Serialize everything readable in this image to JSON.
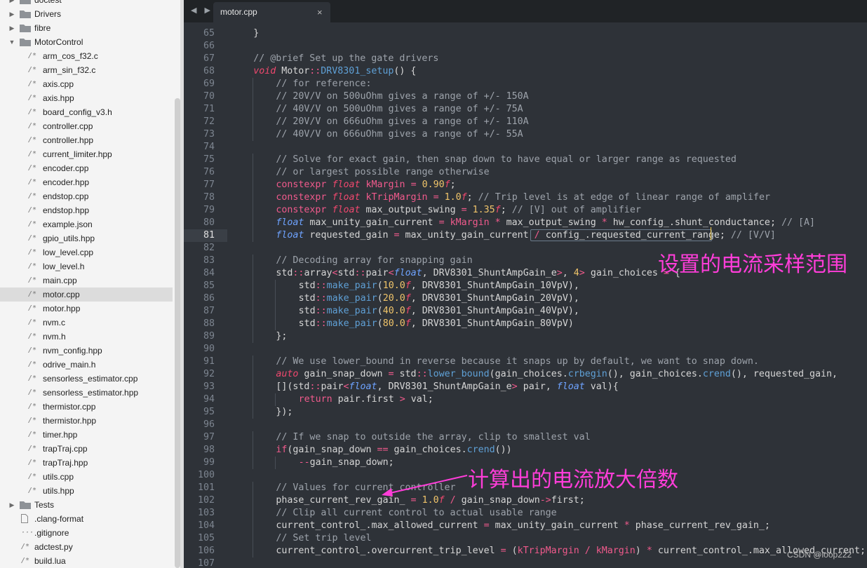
{
  "sidebar": {
    "items": [
      {
        "label": "doctest",
        "type": "folder",
        "state": "collapsed",
        "depth": 1
      },
      {
        "label": "Drivers",
        "type": "folder",
        "state": "collapsed",
        "depth": 1
      },
      {
        "label": "fibre",
        "type": "folder",
        "state": "collapsed",
        "depth": 1
      },
      {
        "label": "MotorControl",
        "type": "folder",
        "state": "open",
        "depth": 1
      },
      {
        "label": "arm_cos_f32.c",
        "type": "file",
        "depth": 2
      },
      {
        "label": "arm_sin_f32.c",
        "type": "file",
        "depth": 2
      },
      {
        "label": "axis.cpp",
        "type": "file",
        "depth": 2
      },
      {
        "label": "axis.hpp",
        "type": "file",
        "depth": 2
      },
      {
        "label": "board_config_v3.h",
        "type": "file",
        "depth": 2
      },
      {
        "label": "controller.cpp",
        "type": "file",
        "depth": 2
      },
      {
        "label": "controller.hpp",
        "type": "file",
        "depth": 2
      },
      {
        "label": "current_limiter.hpp",
        "type": "file",
        "depth": 2
      },
      {
        "label": "encoder.cpp",
        "type": "file",
        "depth": 2
      },
      {
        "label": "encoder.hpp",
        "type": "file",
        "depth": 2
      },
      {
        "label": "endstop.cpp",
        "type": "file",
        "depth": 2
      },
      {
        "label": "endstop.hpp",
        "type": "file",
        "depth": 2
      },
      {
        "label": "example.json",
        "type": "file",
        "depth": 2
      },
      {
        "label": "gpio_utils.hpp",
        "type": "file",
        "depth": 2
      },
      {
        "label": "low_level.cpp",
        "type": "file",
        "depth": 2
      },
      {
        "label": "low_level.h",
        "type": "file",
        "depth": 2
      },
      {
        "label": "main.cpp",
        "type": "file",
        "depth": 2
      },
      {
        "label": "motor.cpp",
        "type": "file",
        "depth": 2,
        "selected": true
      },
      {
        "label": "motor.hpp",
        "type": "file",
        "depth": 2
      },
      {
        "label": "nvm.c",
        "type": "file",
        "depth": 2
      },
      {
        "label": "nvm.h",
        "type": "file",
        "depth": 2
      },
      {
        "label": "nvm_config.hpp",
        "type": "file",
        "depth": 2
      },
      {
        "label": "odrive_main.h",
        "type": "file",
        "depth": 2
      },
      {
        "label": "sensorless_estimator.cpp",
        "type": "file",
        "depth": 2
      },
      {
        "label": "sensorless_estimator.hpp",
        "type": "file",
        "depth": 2
      },
      {
        "label": "thermistor.cpp",
        "type": "file",
        "depth": 2
      },
      {
        "label": "thermistor.hpp",
        "type": "file",
        "depth": 2
      },
      {
        "label": "timer.hpp",
        "type": "file",
        "depth": 2
      },
      {
        "label": "trapTraj.cpp",
        "type": "file",
        "depth": 2
      },
      {
        "label": "trapTraj.hpp",
        "type": "file",
        "depth": 2
      },
      {
        "label": "utils.cpp",
        "type": "file",
        "depth": 2
      },
      {
        "label": "utils.hpp",
        "type": "file",
        "depth": 2
      },
      {
        "label": "Tests",
        "type": "folder",
        "state": "collapsed",
        "depth": 1
      },
      {
        "label": ".clang-format",
        "type": "plainfile",
        "depth": 1
      },
      {
        "label": ".gitignore",
        "type": "dotfile",
        "depth": 1
      },
      {
        "label": "adctest.py",
        "type": "file",
        "depth": 1
      },
      {
        "label": "build.lua",
        "type": "file",
        "depth": 1
      }
    ]
  },
  "tabs": {
    "nav_label": "◀ ▶",
    "active_tab": "motor.cpp",
    "close_icon": "×"
  },
  "editor": {
    "current_line": "81",
    "lines": [
      {
        "n": "65",
        "indent": 4,
        "tokens": [
          [
            "}",
            "pl"
          ]
        ]
      },
      {
        "n": "66",
        "indent": 0,
        "tokens": []
      },
      {
        "n": "67",
        "indent": 4,
        "tokens": [
          [
            "// @brief Set up the gate drivers",
            "cm"
          ]
        ]
      },
      {
        "n": "68",
        "indent": 4,
        "tokens": [
          [
            "void",
            "kw"
          ],
          [
            " Motor",
            "pl"
          ],
          [
            "::",
            "op"
          ],
          [
            "DRV8301_setup",
            "fn"
          ],
          [
            "() {",
            "pl"
          ]
        ]
      },
      {
        "n": "69",
        "indent": 8,
        "tokens": [
          [
            "// for reference:",
            "cm"
          ]
        ]
      },
      {
        "n": "70",
        "indent": 8,
        "tokens": [
          [
            "// 20V/V on 500uOhm gives a range of +/- 150A",
            "cm"
          ]
        ]
      },
      {
        "n": "71",
        "indent": 8,
        "tokens": [
          [
            "// 40V/V on 500uOhm gives a range of +/- 75A",
            "cm"
          ]
        ]
      },
      {
        "n": "72",
        "indent": 8,
        "tokens": [
          [
            "// 20V/V on 666uOhm gives a range of +/- 110A",
            "cm"
          ]
        ]
      },
      {
        "n": "73",
        "indent": 8,
        "tokens": [
          [
            "// 40V/V on 666uOhm gives a range of +/- 55A",
            "cm"
          ]
        ]
      },
      {
        "n": "74",
        "indent": 0,
        "tokens": []
      },
      {
        "n": "75",
        "indent": 8,
        "tokens": [
          [
            "// Solve for exact gain, then snap down to have equal or larger range as requested",
            "cm"
          ]
        ]
      },
      {
        "n": "76",
        "indent": 8,
        "tokens": [
          [
            "// or largest possible range otherwise",
            "cm"
          ]
        ]
      },
      {
        "n": "77",
        "indent": 8,
        "tokens": [
          [
            "constexpr",
            "op"
          ],
          [
            " ",
            "pl"
          ],
          [
            "float",
            "kw"
          ],
          [
            " kMargin ",
            "op"
          ],
          [
            "=",
            "op"
          ],
          [
            " ",
            "pl"
          ],
          [
            "0.90",
            "nu"
          ],
          [
            "f",
            "kw"
          ],
          [
            ";",
            "pl"
          ]
        ]
      },
      {
        "n": "78",
        "indent": 8,
        "tokens": [
          [
            "constexpr",
            "op"
          ],
          [
            " ",
            "pl"
          ],
          [
            "float",
            "kw"
          ],
          [
            " kTripMargin ",
            "op"
          ],
          [
            "=",
            "op"
          ],
          [
            " ",
            "pl"
          ],
          [
            "1.0",
            "nu"
          ],
          [
            "f",
            "kw"
          ],
          [
            "; ",
            "pl"
          ],
          [
            "// Trip level is at edge of linear range of amplifer",
            "cm"
          ]
        ]
      },
      {
        "n": "79",
        "indent": 8,
        "tokens": [
          [
            "constexpr",
            "op"
          ],
          [
            " ",
            "pl"
          ],
          [
            "float",
            "kw"
          ],
          [
            " max_output_swing ",
            "pl"
          ],
          [
            "=",
            "op"
          ],
          [
            " ",
            "pl"
          ],
          [
            "1.35",
            "nu"
          ],
          [
            "f",
            "kw"
          ],
          [
            "; ",
            "pl"
          ],
          [
            "// [V] out of amplifier",
            "cm"
          ]
        ]
      },
      {
        "n": "80",
        "indent": 8,
        "tokens": [
          [
            "float",
            "ty"
          ],
          [
            " max_unity_gain_current ",
            "pl"
          ],
          [
            "=",
            "op"
          ],
          [
            " kMargin ",
            "op"
          ],
          [
            "*",
            "op"
          ],
          [
            " max_output_swing ",
            "pl"
          ],
          [
            "*",
            "op"
          ],
          [
            " hw_config_.shunt_conductance; ",
            "pl"
          ],
          [
            "// [A]",
            "cm"
          ]
        ]
      },
      {
        "n": "81",
        "indent": 8,
        "tokens": [
          [
            "float",
            "ty"
          ],
          [
            " requested_gain ",
            "pl"
          ],
          [
            "=",
            "op"
          ],
          [
            " max_unity_gain_current ",
            "pl"
          ],
          [
            "/",
            "op"
          ],
          [
            " config_.requested_current_range; ",
            "pl"
          ],
          [
            "// [V/V]",
            "cm"
          ]
        ]
      },
      {
        "n": "82",
        "indent": 0,
        "tokens": []
      },
      {
        "n": "83",
        "indent": 8,
        "tokens": [
          [
            "// Decoding array for snapping gain",
            "cm"
          ]
        ]
      },
      {
        "n": "84",
        "indent": 8,
        "tokens": [
          [
            "std",
            "pl"
          ],
          [
            "::",
            "op"
          ],
          [
            "array",
            "pl"
          ],
          [
            "<",
            "op"
          ],
          [
            "std",
            "pl"
          ],
          [
            "::",
            "op"
          ],
          [
            "pair",
            "pl"
          ],
          [
            "<",
            "op"
          ],
          [
            "float",
            "ty"
          ],
          [
            ", DRV8301_ShuntAmpGain_e",
            "pl"
          ],
          [
            ">",
            "op"
          ],
          [
            ", ",
            "pl"
          ],
          [
            "4",
            "nu"
          ],
          [
            ">",
            "op"
          ],
          [
            " gain_choices ",
            "pl"
          ],
          [
            "=",
            "op"
          ],
          [
            " {",
            "pl"
          ]
        ]
      },
      {
        "n": "85",
        "indent": 12,
        "tokens": [
          [
            "std",
            "pl"
          ],
          [
            "::",
            "op"
          ],
          [
            "make_pair",
            "fn"
          ],
          [
            "(",
            "pl"
          ],
          [
            "10.0",
            "nu"
          ],
          [
            "f",
            "kw"
          ],
          [
            ", DRV8301_ShuntAmpGain_10VpV),",
            "pl"
          ]
        ]
      },
      {
        "n": "86",
        "indent": 12,
        "tokens": [
          [
            "std",
            "pl"
          ],
          [
            "::",
            "op"
          ],
          [
            "make_pair",
            "fn"
          ],
          [
            "(",
            "pl"
          ],
          [
            "20.0",
            "nu"
          ],
          [
            "f",
            "kw"
          ],
          [
            ", DRV8301_ShuntAmpGain_20VpV),",
            "pl"
          ]
        ]
      },
      {
        "n": "87",
        "indent": 12,
        "tokens": [
          [
            "std",
            "pl"
          ],
          [
            "::",
            "op"
          ],
          [
            "make_pair",
            "fn"
          ],
          [
            "(",
            "pl"
          ],
          [
            "40.0",
            "nu"
          ],
          [
            "f",
            "kw"
          ],
          [
            ", DRV8301_ShuntAmpGain_40VpV),",
            "pl"
          ]
        ]
      },
      {
        "n": "88",
        "indent": 12,
        "tokens": [
          [
            "std",
            "pl"
          ],
          [
            "::",
            "op"
          ],
          [
            "make_pair",
            "fn"
          ],
          [
            "(",
            "pl"
          ],
          [
            "80.0",
            "nu"
          ],
          [
            "f",
            "kw"
          ],
          [
            ", DRV8301_ShuntAmpGain_80VpV)",
            "pl"
          ]
        ]
      },
      {
        "n": "89",
        "indent": 8,
        "tokens": [
          [
            "};",
            "pl"
          ]
        ]
      },
      {
        "n": "90",
        "indent": 0,
        "tokens": []
      },
      {
        "n": "91",
        "indent": 8,
        "tokens": [
          [
            "// We use lower_bound in reverse because it snaps up by default, we want to snap down.",
            "cm"
          ]
        ]
      },
      {
        "n": "92",
        "indent": 8,
        "tokens": [
          [
            "auto",
            "kw"
          ],
          [
            " gain_snap_down ",
            "pl"
          ],
          [
            "=",
            "op"
          ],
          [
            " std",
            "pl"
          ],
          [
            "::",
            "op"
          ],
          [
            "lower_bound",
            "fn"
          ],
          [
            "(gain_choices.",
            "pl"
          ],
          [
            "crbegin",
            "fn"
          ],
          [
            "(), gain_choices.",
            "pl"
          ],
          [
            "crend",
            "fn"
          ],
          [
            "(), requested_gain,",
            "pl"
          ]
        ]
      },
      {
        "n": "93",
        "indent": 8,
        "tokens": [
          [
            "[](std",
            "pl"
          ],
          [
            "::",
            "op"
          ],
          [
            "pair",
            "pl"
          ],
          [
            "<",
            "op"
          ],
          [
            "float",
            "ty"
          ],
          [
            ", DRV8301_ShuntAmpGain_e",
            "pl"
          ],
          [
            ">",
            "op"
          ],
          [
            " pair, ",
            "pl"
          ],
          [
            "float",
            "ty"
          ],
          [
            " val){",
            "pl"
          ]
        ]
      },
      {
        "n": "94",
        "indent": 12,
        "tokens": [
          [
            "return",
            "op"
          ],
          [
            " pair.first ",
            "pl"
          ],
          [
            ">",
            "op"
          ],
          [
            " val;",
            "pl"
          ]
        ]
      },
      {
        "n": "95",
        "indent": 8,
        "tokens": [
          [
            "});",
            "pl"
          ]
        ]
      },
      {
        "n": "96",
        "indent": 0,
        "tokens": []
      },
      {
        "n": "97",
        "indent": 8,
        "tokens": [
          [
            "// If we snap to outside the array, clip to smallest val",
            "cm"
          ]
        ]
      },
      {
        "n": "98",
        "indent": 8,
        "tokens": [
          [
            "if",
            "op"
          ],
          [
            "(gain_snap_down ",
            "pl"
          ],
          [
            "==",
            "op"
          ],
          [
            " gain_choices.",
            "pl"
          ],
          [
            "crend",
            "fn"
          ],
          [
            "())",
            "pl"
          ]
        ]
      },
      {
        "n": "99",
        "indent": 12,
        "tokens": [
          [
            "--",
            "op"
          ],
          [
            "gain_snap_down;",
            "pl"
          ]
        ]
      },
      {
        "n": "100",
        "indent": 0,
        "tokens": []
      },
      {
        "n": "101",
        "indent": 8,
        "tokens": [
          [
            "// Values for current controller",
            "cm"
          ]
        ]
      },
      {
        "n": "102",
        "indent": 8,
        "tokens": [
          [
            "phase_current_rev_gain_ ",
            "pl"
          ],
          [
            "=",
            "op"
          ],
          [
            " ",
            "pl"
          ],
          [
            "1.0",
            "nu"
          ],
          [
            "f",
            "kw"
          ],
          [
            " ",
            "pl"
          ],
          [
            "/",
            "op"
          ],
          [
            " gain_snap_down",
            "pl"
          ],
          [
            "->",
            "op"
          ],
          [
            "first;",
            "pl"
          ]
        ]
      },
      {
        "n": "103",
        "indent": 8,
        "tokens": [
          [
            "// Clip all current control to actual usable range",
            "cm"
          ]
        ]
      },
      {
        "n": "104",
        "indent": 8,
        "tokens": [
          [
            "current_control_.max_allowed_current ",
            "pl"
          ],
          [
            "=",
            "op"
          ],
          [
            " max_unity_gain_current ",
            "pl"
          ],
          [
            "*",
            "op"
          ],
          [
            " phase_current_rev_gain_;",
            "pl"
          ]
        ]
      },
      {
        "n": "105",
        "indent": 8,
        "tokens": [
          [
            "// Set trip level",
            "cm"
          ]
        ]
      },
      {
        "n": "106",
        "indent": 8,
        "tokens": [
          [
            "current_control_.overcurrent_trip_level ",
            "pl"
          ],
          [
            "=",
            "op"
          ],
          [
            " (",
            "pl"
          ],
          [
            "kTripMargin",
            "op"
          ],
          [
            " ",
            "pl"
          ],
          [
            "/",
            "op"
          ],
          [
            " ",
            "pl"
          ],
          [
            "kMargin",
            "op"
          ],
          [
            ") ",
            "pl"
          ],
          [
            "*",
            "op"
          ],
          [
            " current_control_.max_allowed_current;",
            "pl"
          ]
        ]
      },
      {
        "n": "107",
        "indent": 0,
        "tokens": []
      }
    ]
  },
  "annotations": {
    "range_label": "设置的电流采样范围",
    "gain_label": "计算出的电流放大倍数"
  },
  "watermark": "CSDN @loop222",
  "colors": {
    "annotation": "#ff3dd9",
    "background": "#2e3238",
    "sidebar": "#f4f4f4"
  }
}
